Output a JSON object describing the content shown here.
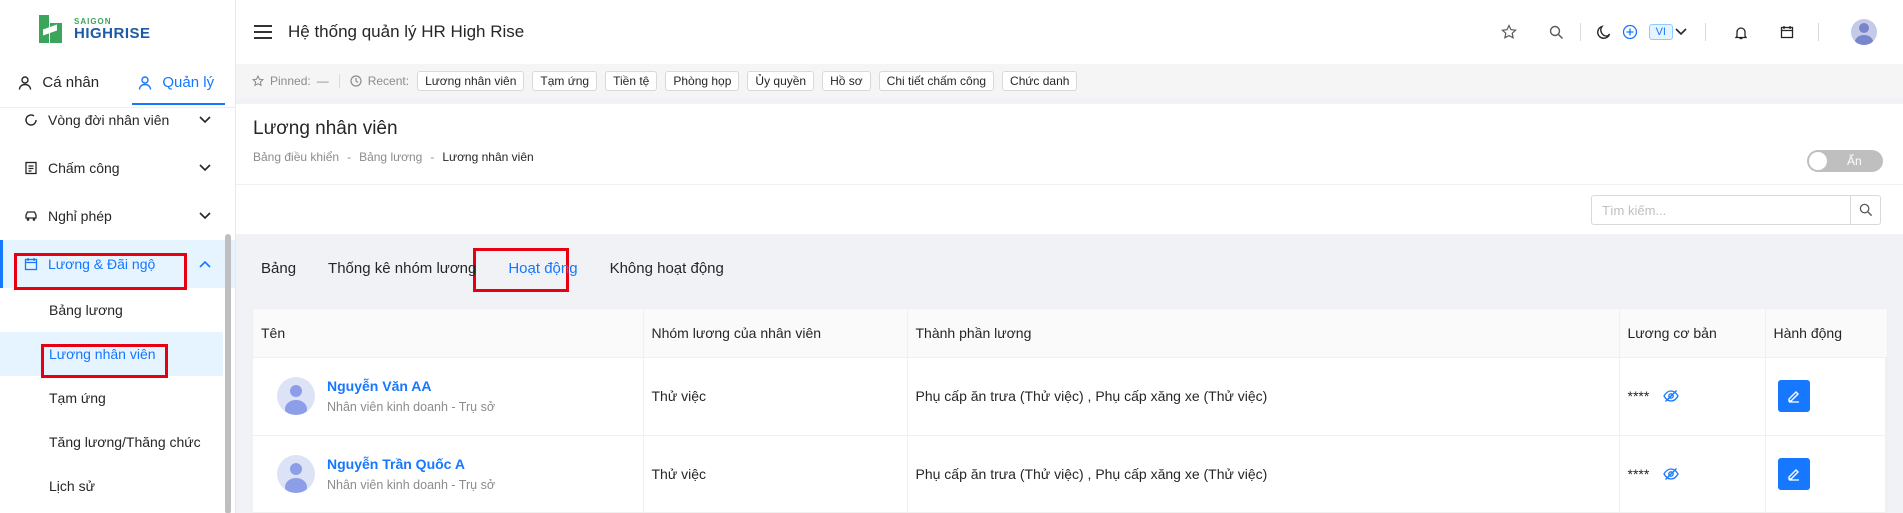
{
  "brand": {
    "line1": "SAIGON",
    "line2": "HIGHRISE"
  },
  "mode_tabs": [
    {
      "label": "Cá nhân"
    },
    {
      "label": "Quản lý"
    }
  ],
  "menu": {
    "items": [
      {
        "label": "Vòng đời nhân viên"
      },
      {
        "label": "Chấm công"
      },
      {
        "label": "Nghỉ phép"
      },
      {
        "label": "Lương & Đãi ngộ"
      }
    ],
    "sub_items": [
      {
        "label": "Bảng lương"
      },
      {
        "label": "Lương nhân viên"
      },
      {
        "label": "Tạm ứng"
      },
      {
        "label": "Tăng lương/Thăng chức"
      },
      {
        "label": "Lịch sử"
      }
    ]
  },
  "header": {
    "title": "Hệ thống quản lý HR High Rise",
    "lang": "VI"
  },
  "recent_bar": {
    "pinned_label": "Pinned:",
    "pinned_value": "—",
    "recent_label": "Recent:",
    "chips": [
      "Lương nhân viên",
      "Tạm ứng",
      "Tiền tệ",
      "Phòng họp",
      "Ủy quyền",
      "Hồ sơ",
      "Chi tiết chấm công",
      "Chức danh"
    ]
  },
  "page": {
    "title": "Lương nhân viên",
    "breadcrumb": [
      "Bảng điều khiển",
      "Bảng lương",
      "Lương nhân viên"
    ],
    "breadcrumb_sep": "-",
    "toggle_label": "Ẩn"
  },
  "search": {
    "placeholder": "Tìm kiếm..."
  },
  "tabs": [
    {
      "label": "Bảng"
    },
    {
      "label": "Thống kê nhóm lương"
    },
    {
      "label": "Hoạt động"
    },
    {
      "label": "Không hoạt động"
    }
  ],
  "table": {
    "columns": [
      "Tên",
      "Nhóm lương của nhân viên",
      "Thành phần lương",
      "Lương cơ bản",
      "Hành động"
    ],
    "rows": [
      {
        "name": "Nguyễn Văn AA",
        "sub": "Nhân viên kinh doanh - Trụ sở",
        "group": "Thử việc",
        "components": "Phụ cấp ăn trưa (Thử việc) , Phụ cấp xăng xe (Thử việc)",
        "base_salary": "****"
      },
      {
        "name": "Nguyễn Trần Quốc A",
        "sub": "Nhân viên kinh doanh - Trụ sở",
        "group": "Thử việc",
        "components": "Phụ cấp ăn trưa (Thử việc) , Phụ cấp xăng xe (Thử việc)",
        "base_salary": "****"
      }
    ]
  }
}
